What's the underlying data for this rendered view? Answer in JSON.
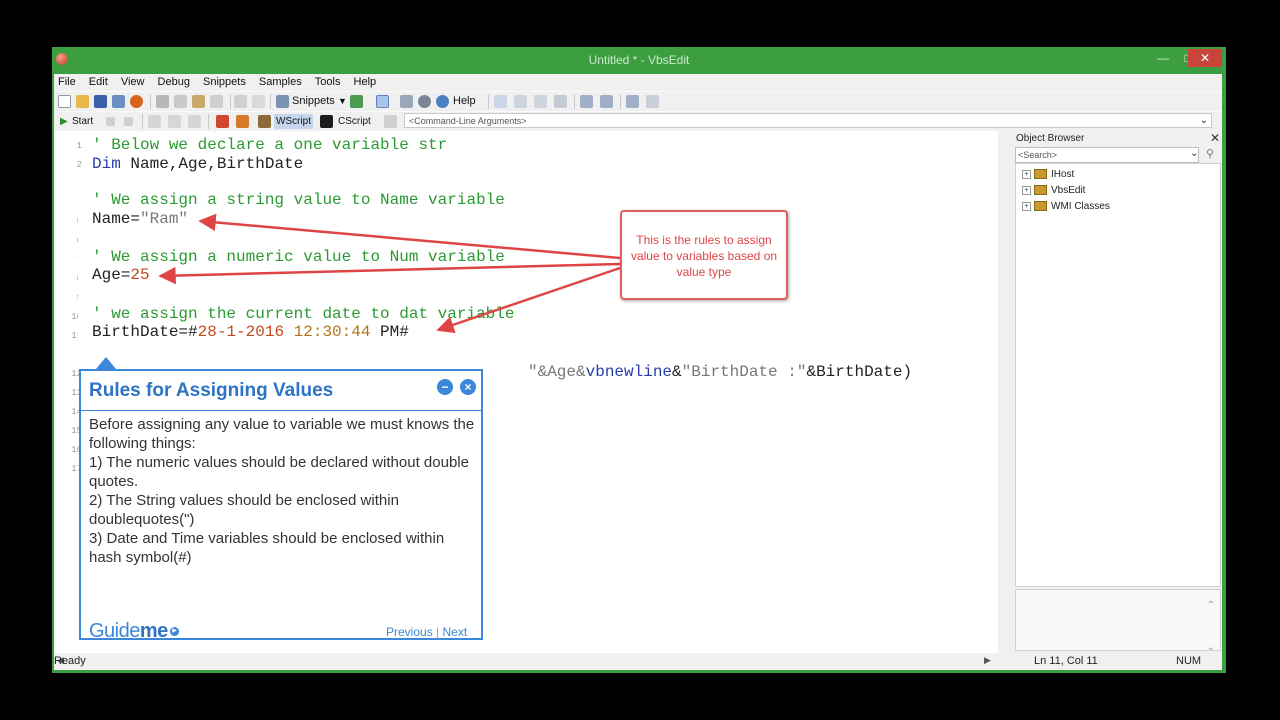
{
  "window": {
    "title": "Untitled * - VbsEdit"
  },
  "menu": [
    "File",
    "Edit",
    "View",
    "Debug",
    "Snippets",
    "Samples",
    "Tools",
    "Help"
  ],
  "toolbar": {
    "snippets_label": "Snippets",
    "help_label": "Help"
  },
  "toolbar2": {
    "start_label": "Start",
    "wscript_label": "WScript",
    "cscript_label": "CScript",
    "cmd_args_placeholder": "<Command-Line Arguments>"
  },
  "editor": {
    "line_numbers": [
      "1",
      "2",
      "5",
      "6",
      "7",
      "8",
      "9",
      "10",
      "11",
      "12",
      "13",
      "14",
      "15",
      "16",
      "17"
    ],
    "lines": {
      "l1": "' Below we declare a one variable str",
      "l2_kw": "Dim",
      "l2_rest": " Name,Age,BirthDate",
      "l12_a": "\"&Age&",
      "l12_b": "vbnewline",
      "l12_c": "&",
      "l12_d": "\"BirthDate :\"",
      "l12_e": "&BirthDate)"
    }
  },
  "overlay": {
    "c1": "' We assign a string value to Name variable",
    "name_assign": "Name=",
    "name_value": "\"Ram\"",
    "c2": "' We assign a numeric value to Num variable",
    "age_assign": "Age=",
    "age_value": "25",
    "c3": "' we assign the current date to dat variable",
    "bd_assign": "BirthDate=",
    "bd_hash1": "#",
    "bd_date": "28-1-2016 ",
    "bd_time": "12:30:44",
    "bd_pm": " PM#",
    "callout": "This is the rules to assign value to variables based on value type"
  },
  "object_browser": {
    "title": "Object Browser",
    "search_placeholder": "<Search>",
    "items": [
      "IHost",
      "VbsEdit",
      "WMI Classes"
    ]
  },
  "status": {
    "left": "Ready",
    "position": "Ln 11, Col 11",
    "mode": "NUM"
  },
  "guide": {
    "title": "Rules for Assigning Values",
    "body": [
      "Before assigning any value to variable we must knows the following things:",
      "1) The numeric values should be declared without double quotes.",
      "2) The String values should be enclosed within doublequotes(\")",
      "3) Date and Time variables should be enclosed within hash symbol(#)"
    ],
    "logo_a": "Guide",
    "logo_b": "me",
    "nav_prev": "Previous",
    "nav_sep": "|",
    "nav_next": "Next"
  },
  "colors": {
    "titlebar": "#3c9e3e",
    "accent": "#3b87d9",
    "callout_red": "#e04545",
    "comment_green": "#2a9a32",
    "keyword_blue": "#2a3dab"
  }
}
